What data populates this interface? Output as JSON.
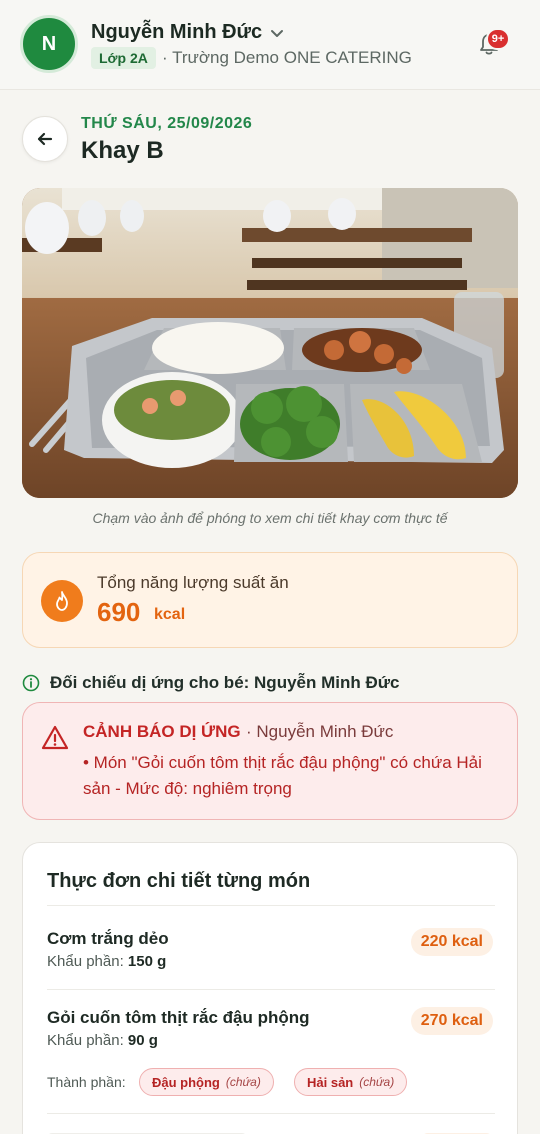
{
  "header": {
    "avatar_initial": "N",
    "user_name": "Nguyễn Minh Đức",
    "class_label": "Lớp 2A",
    "school": "· Trường Demo ONE CATERING",
    "notification_count": "9+"
  },
  "title": {
    "date": "THỨ SÁU, 25/09/2026",
    "tray_name": "Khay B"
  },
  "photo": {
    "caption": "Chạm vào ảnh để phóng to xem chi tiết khay cơm thực tế"
  },
  "energy": {
    "label": "Tổng năng lượng suất ăn",
    "value": "690",
    "unit": "kcal"
  },
  "allergy": {
    "heading": "Đối chiếu dị ứng cho bé: Nguyễn Minh Đức",
    "warning_title": "CẢNH BÁO DỊ ỨNG",
    "warning_child": "· Nguyễn Minh Đức",
    "warning_text": "• Món \"Gỏi cuốn tôm thịt rắc đậu phộng\" có chứa Hải sản - Mức độ: nghiêm trọng"
  },
  "menu": {
    "title": "Thực đơn chi tiết từng món",
    "portion_label": "Khẩu phần:",
    "ingredients_label": "Thành phần:",
    "dishes": [
      {
        "name": "Cơm trắng dẻo",
        "portion": "150 g",
        "kcal": "220 kcal"
      },
      {
        "name": "Gỏi cuốn tôm thịt rắc đậu phộng",
        "portion": "90 g",
        "kcal": "270 kcal",
        "ingredients": [
          {
            "name": "Đậu phộng",
            "note": "(chứa)"
          },
          {
            "name": "Hải sản",
            "note": "(chứa)"
          }
        ]
      }
    ]
  },
  "colors": {
    "brand_green": "#1f8a3f",
    "accent_orange": "#e36410",
    "alert_red": "#c42525"
  }
}
